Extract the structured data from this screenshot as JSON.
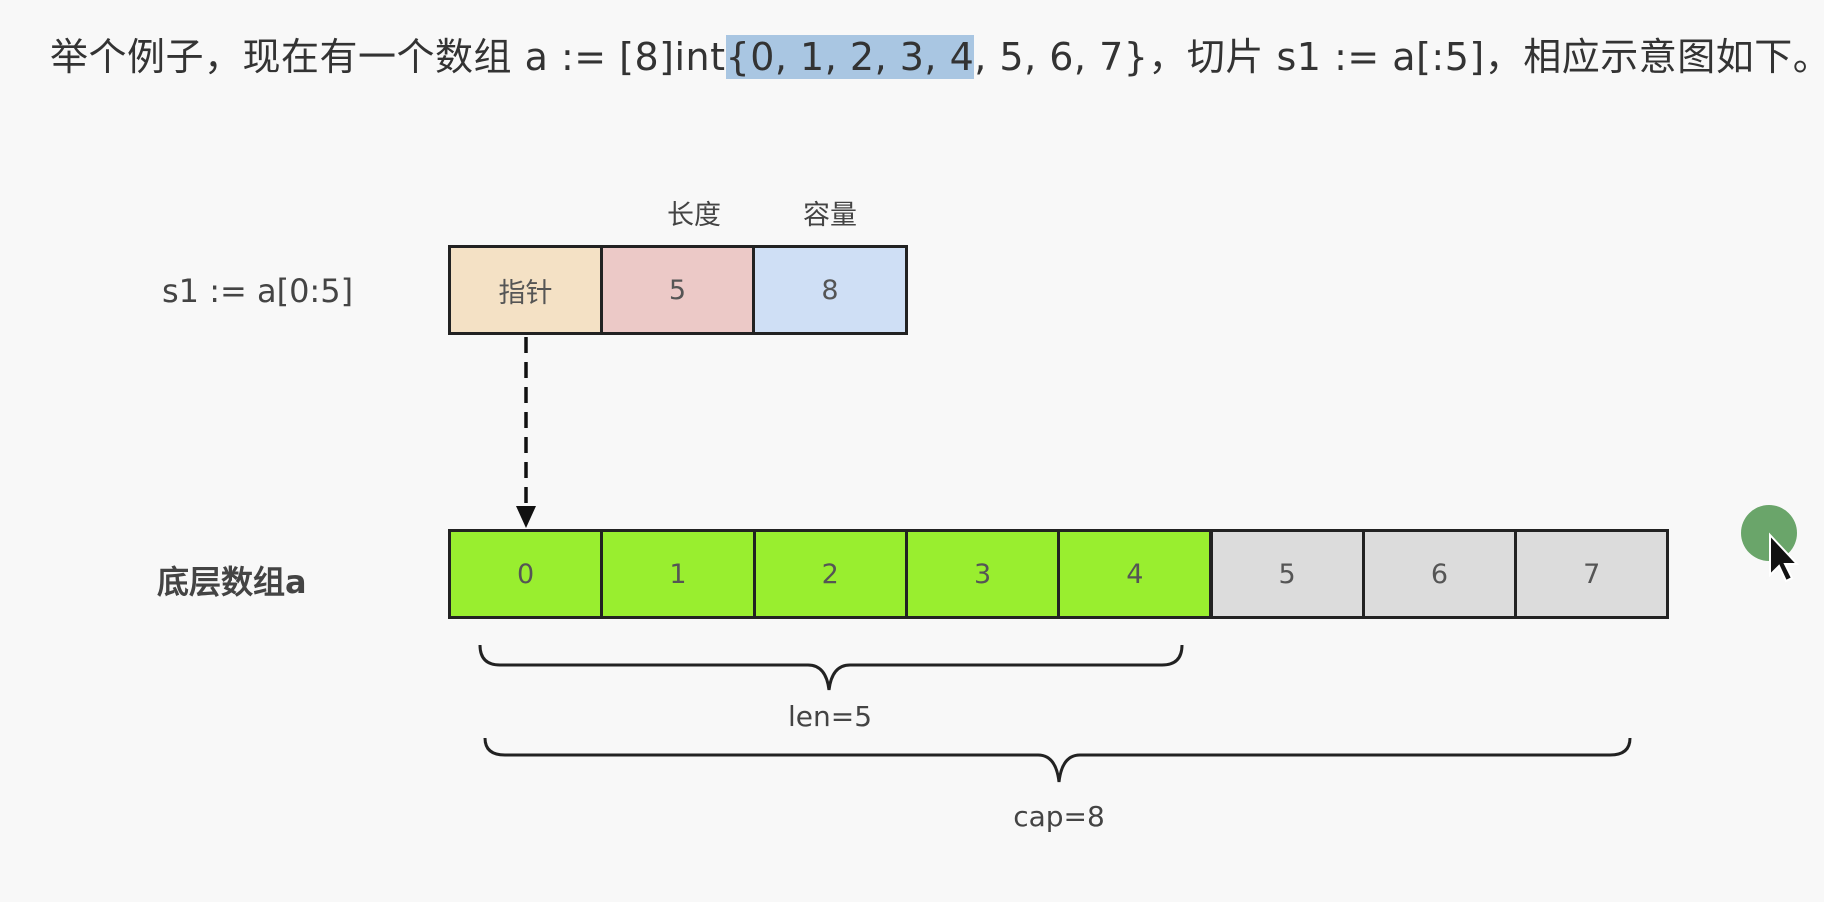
{
  "intro": {
    "before": "举个例子，现在有一个数组 a := [8]int",
    "highlight": "{0, 1, 2, 3, 4",
    "after": ", 5, 6, 7}，切片 s1 := a[:5]，相应示意图如下。"
  },
  "slice": {
    "label": "s1 := a[0:5]",
    "header_len": "长度",
    "header_cap": "容量",
    "pointer": "指针",
    "len_value": "5",
    "cap_value": "8",
    "colors": {
      "pointer": "#f4e1c5",
      "len": "#ecc9c7",
      "cap": "#cfdff5"
    }
  },
  "array": {
    "label": "底层数组a",
    "elements": [
      "0",
      "1",
      "2",
      "3",
      "4",
      "5",
      "6",
      "7"
    ],
    "in_slice_count": 5,
    "colors": {
      "in_slice": "#99ee2f",
      "out_slice": "#dcdcdc"
    }
  },
  "braces": {
    "len_label": "len=5",
    "cap_label": "cap=8"
  }
}
